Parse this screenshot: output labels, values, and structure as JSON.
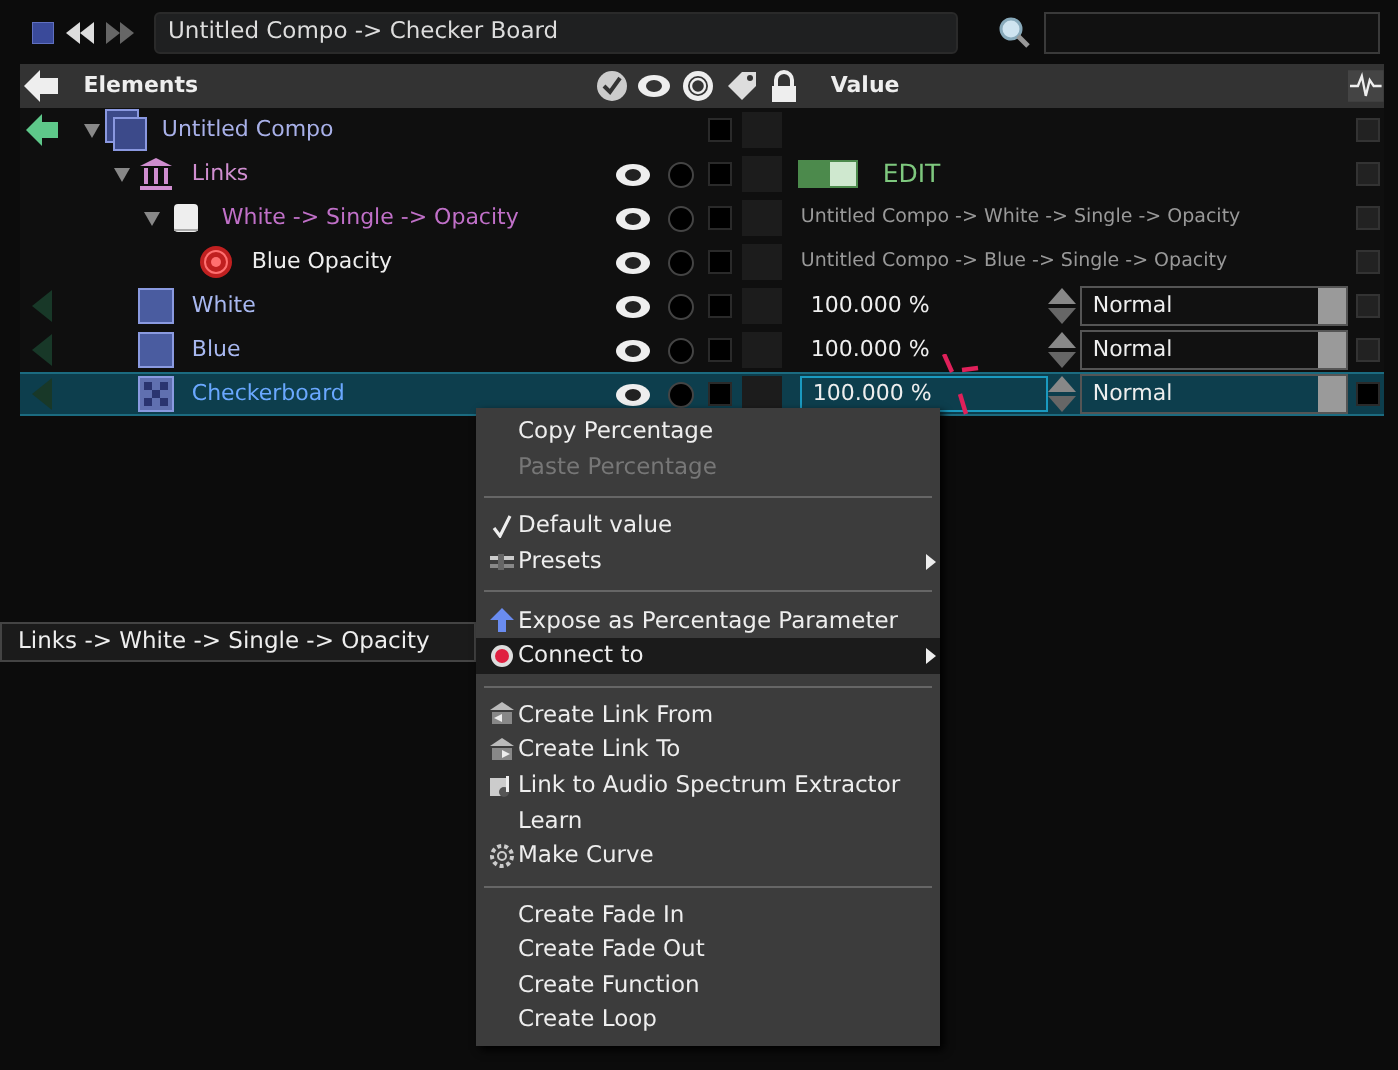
{
  "toolbar": {
    "path": "Untitled Compo -> Checker Board"
  },
  "header": {
    "elements": "Elements",
    "value": "Value"
  },
  "tree": [
    {
      "label": "Untitled Compo",
      "kind": "compo",
      "expanded": true,
      "selected": false,
      "children": [
        {
          "label": "Links",
          "kind": "links",
          "expanded": true,
          "selected": false,
          "value": {
            "kind": "toggle",
            "on": true,
            "text": "EDIT"
          },
          "children": [
            {
              "label": "White -> Single -> Opacity",
              "kind": "link",
              "expanded": true,
              "selected": false,
              "value": {
                "kind": "path",
                "text": "Untitled Compo -> White -> Single -> Opacity"
              },
              "children": [
                {
                  "label": "Blue Opacity",
                  "kind": "target",
                  "selected": false,
                  "value": {
                    "kind": "path",
                    "text": "Untitled Compo -> Blue -> Single -> Opacity"
                  }
                }
              ]
            }
          ]
        },
        {
          "label": "White",
          "kind": "layer",
          "selected": false,
          "value": {
            "kind": "percent",
            "text": "100.000 %",
            "blend": "Normal"
          }
        },
        {
          "label": "Blue",
          "kind": "layer",
          "selected": false,
          "value": {
            "kind": "percent",
            "text": "100.000 %",
            "blend": "Normal"
          }
        },
        {
          "label": "Checkerboard",
          "kind": "checker",
          "selected": true,
          "value": {
            "kind": "percent",
            "text": "100.000 %",
            "blend": "Normal"
          }
        }
      ]
    }
  ],
  "tooltip": "Links -> White -> Single -> Opacity",
  "menu": [
    [
      {
        "label": "Copy Percentage",
        "kind": "plain",
        "disabled": false,
        "selected": false
      },
      {
        "label": "Paste Percentage",
        "kind": "plain",
        "disabled": true,
        "selected": false
      }
    ],
    [
      {
        "label": "Default value",
        "kind": "check",
        "disabled": false,
        "selected": false
      },
      {
        "label": "Presets",
        "kind": "presets",
        "disabled": false,
        "selected": false,
        "submenu": true
      }
    ],
    [
      {
        "label": "Expose as Percentage Parameter",
        "kind": "expose",
        "disabled": false,
        "selected": false
      },
      {
        "label": "Connect to",
        "kind": "connect",
        "disabled": false,
        "selected": true,
        "submenu": true
      }
    ],
    [
      {
        "label": "Create Link From",
        "kind": "linkfrom",
        "disabled": false,
        "selected": false
      },
      {
        "label": "Create Link To",
        "kind": "linkto",
        "disabled": false,
        "selected": false
      },
      {
        "label": "Link to Audio Spectrum Extractor",
        "kind": "audio",
        "disabled": false,
        "selected": false
      },
      {
        "label": "Learn",
        "kind": "plain",
        "disabled": false,
        "selected": false
      },
      {
        "label": "Make Curve",
        "kind": "curve",
        "disabled": false,
        "selected": false
      }
    ],
    [
      {
        "label": "Create Fade In",
        "kind": "plain",
        "disabled": false,
        "selected": false
      },
      {
        "label": "Create Fade Out",
        "kind": "plain",
        "disabled": false,
        "selected": false
      },
      {
        "label": "Create Function",
        "kind": "plain",
        "disabled": false,
        "selected": false
      },
      {
        "label": "Create Loop",
        "kind": "plain",
        "disabled": false,
        "selected": false
      }
    ]
  ]
}
